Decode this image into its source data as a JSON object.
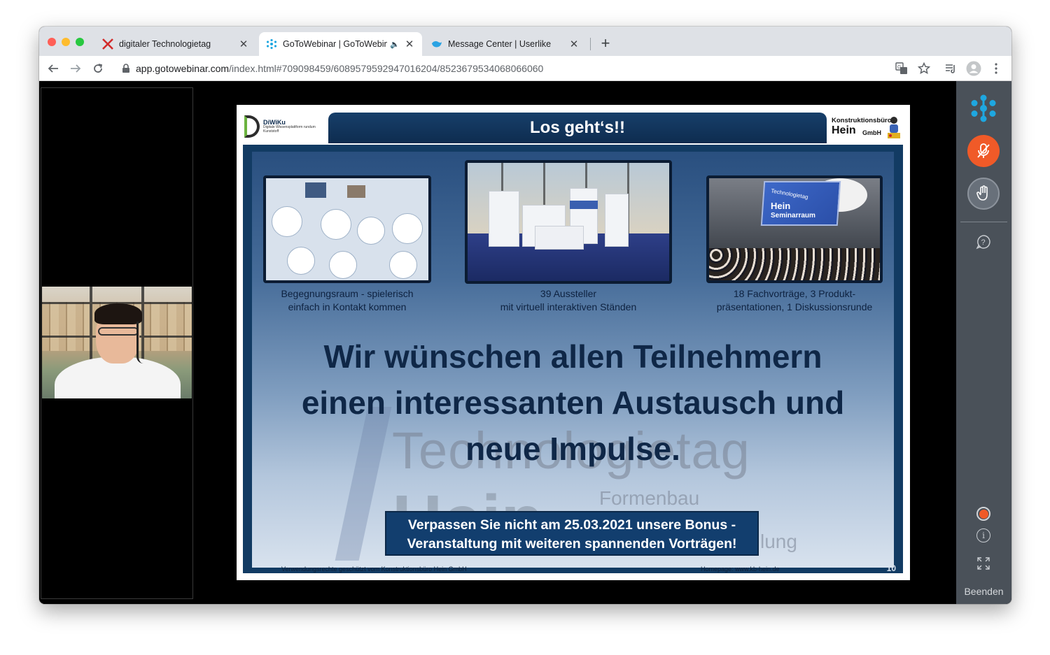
{
  "browser": {
    "tabs": [
      {
        "title": "digitaler Technologietag",
        "icon": "x-logo-icon"
      },
      {
        "title": "GoToWebinar | GoToWebinar",
        "icon": "gotowebinar-icon",
        "audio": "🔈"
      },
      {
        "title": "Message Center | Userlike",
        "icon": "userlike-icon"
      }
    ],
    "new_tab_label": "+",
    "url_domain": "app.gotowebinar.com",
    "url_path": "/index.html#709098459/6089579592947016204/8523679534068066060"
  },
  "slide": {
    "title": "Los geht‘s!!",
    "logo_left": {
      "name": "DiWiKu",
      "subtitle": "Digitale Wissensplattform rundum Kunststoff"
    },
    "logo_right": {
      "line1": "Konstruktionsbüro",
      "line2": "Hein",
      "line3": "GmbH"
    },
    "thumbnails": [
      {
        "caption_line1": "Begegnungsraum - spielerisch",
        "caption_line2": "einfach in Kontakt kommen"
      },
      {
        "caption_line1": "39 Aussteller",
        "caption_line2": "mit virtuell interaktiven Ständen"
      },
      {
        "caption_line1": "18 Fachvorträge, 3 Produkt-",
        "caption_line2": "präsentationen, 1 Diskussionsrunde",
        "screen_line1": "Technologietag",
        "screen_line2": "Hein",
        "screen_line3": "Seminarraum"
      }
    ],
    "message_line1": "Wir wünschen allen Teilnehmern",
    "message_line2": "einen interessanten Austausch und",
    "message_line3": "neue Impulse.",
    "bonus_line1": "Verpassen Sie nicht am 25.03.2021 unsere Bonus -",
    "bonus_line2": "Veranstaltung mit weiteren spannenden Vorträgen!",
    "watermark_main": "Technologietag",
    "watermark_hein": "Hein",
    "watermark_form": "Formenbau",
    "watermark_lung": "lung",
    "footer_left": "Verwendungsrechte geschützt vom Konstruktionsbüro Hein GmbH",
    "footer_right": "Homepage: www.kb-hein.de",
    "page_number": "10"
  },
  "side_panel": {
    "end_label": "Beenden",
    "mic_color": "#f05a28",
    "accent": "#1ea7e0"
  }
}
